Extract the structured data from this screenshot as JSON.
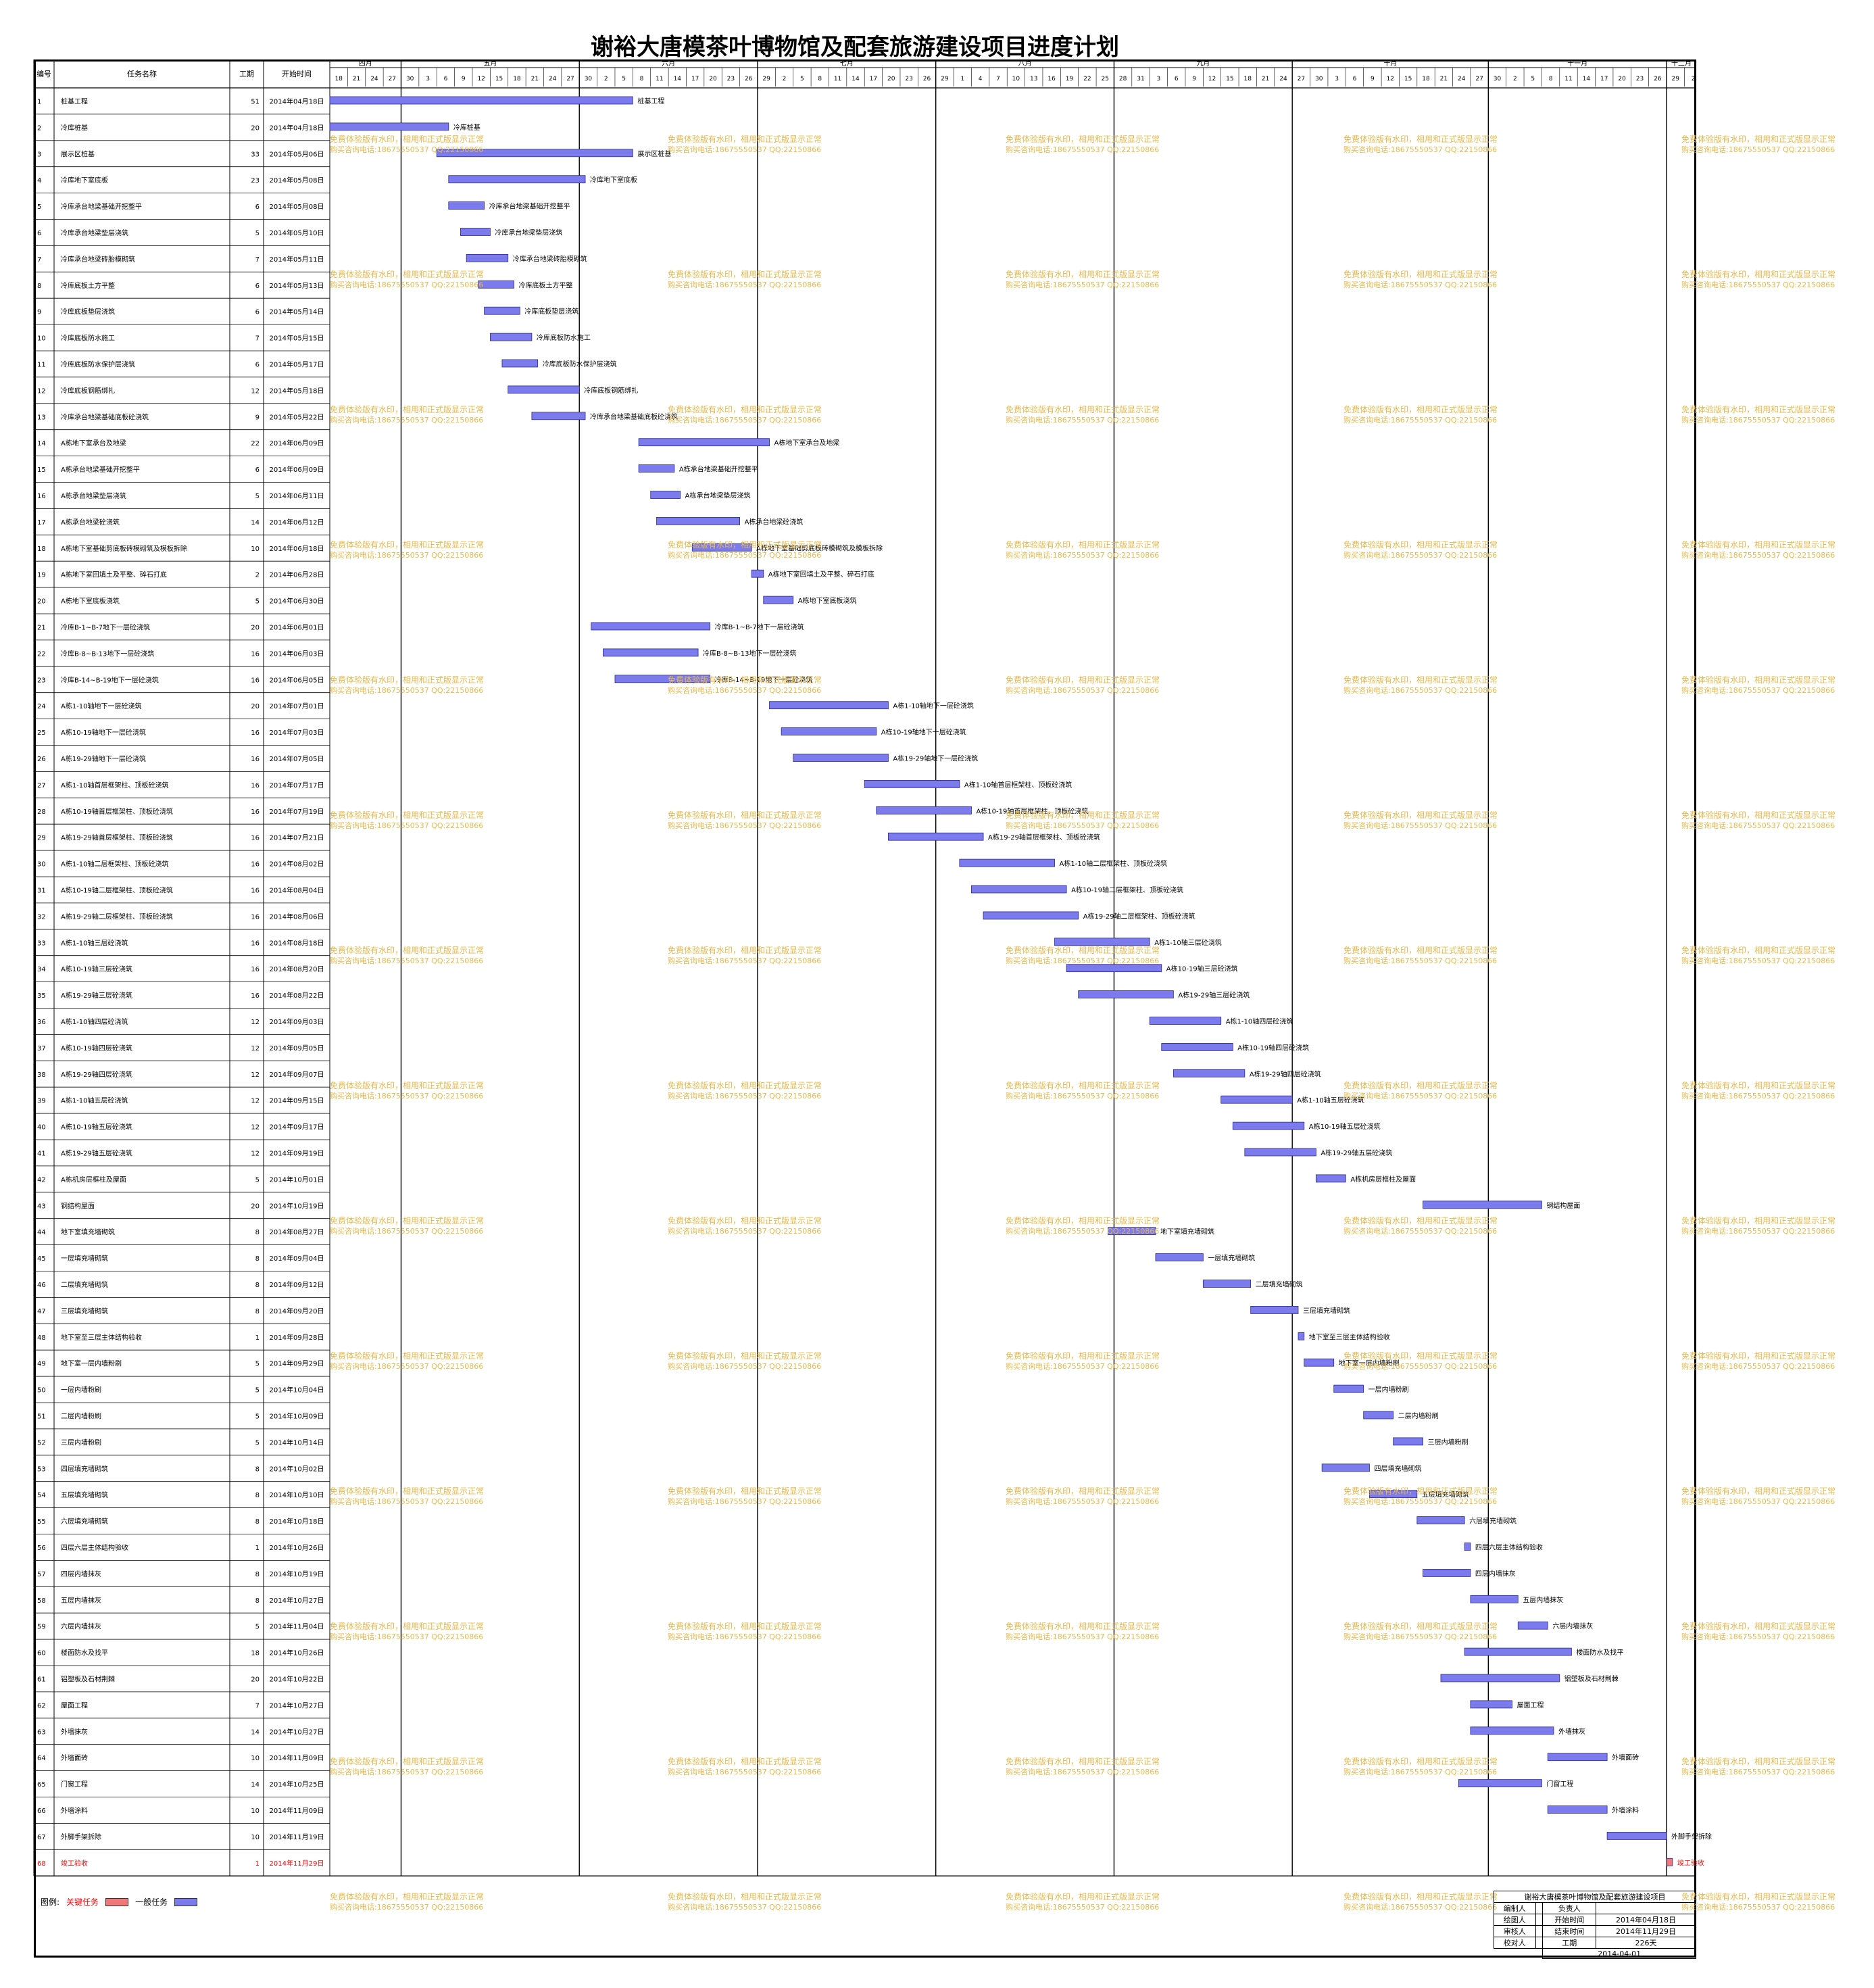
{
  "title": "谢裕大唐模茶叶博物馆及配套旅游建设项目进度计划",
  "columns": {
    "no": "编号",
    "name": "任务名称",
    "dur": "工期",
    "start": "开始时间"
  },
  "timeline": {
    "start": "2014-04-18",
    "end": "2014-12-04",
    "tick_days": 3,
    "months": [
      {
        "label": "四月",
        "start": "2014-04-18"
      },
      {
        "label": "五月",
        "start": "2014-04-30"
      },
      {
        "label": "六月",
        "start": "2014-05-30"
      },
      {
        "label": "七月",
        "start": "2014-06-29"
      },
      {
        "label": "八月",
        "start": "2014-07-29"
      },
      {
        "label": "九月",
        "start": "2014-08-28"
      },
      {
        "label": "十月",
        "start": "2014-09-27"
      },
      {
        "label": "十一月",
        "start": "2014-10-30"
      },
      {
        "label": "十二月",
        "start": "2014-11-29"
      }
    ]
  },
  "chart_data": {
    "type": "gantt",
    "tasks": [
      {
        "id": 1,
        "name": "桩基工程",
        "dur": 51,
        "start": "2014年04月18日"
      },
      {
        "id": 2,
        "name": "冷库桩基",
        "dur": 20,
        "start": "2014年04月18日"
      },
      {
        "id": 3,
        "name": "展示区桩基",
        "dur": 33,
        "start": "2014年05月06日"
      },
      {
        "id": 4,
        "name": "冷库地下室底板",
        "dur": 23,
        "start": "2014年05月08日"
      },
      {
        "id": 5,
        "name": "冷库承台地梁基础开挖整平",
        "dur": 6,
        "start": "2014年05月08日"
      },
      {
        "id": 6,
        "name": "冷库承台地梁垫层浇筑",
        "dur": 5,
        "start": "2014年05月10日"
      },
      {
        "id": 7,
        "name": "冷库承台地梁砖胎模砌筑",
        "dur": 7,
        "start": "2014年05月11日"
      },
      {
        "id": 8,
        "name": "冷库底板土方平整",
        "dur": 6,
        "start": "2014年05月13日"
      },
      {
        "id": 9,
        "name": "冷库底板垫层浇筑",
        "dur": 6,
        "start": "2014年05月14日"
      },
      {
        "id": 10,
        "name": "冷库底板防水施工",
        "dur": 7,
        "start": "2014年05月15日"
      },
      {
        "id": 11,
        "name": "冷库底板防水保护层浇筑",
        "dur": 6,
        "start": "2014年05月17日"
      },
      {
        "id": 12,
        "name": "冷库底板钢筋绑扎",
        "dur": 12,
        "start": "2014年05月18日"
      },
      {
        "id": 13,
        "name": "冷库承台地梁基础底板砼浇筑",
        "dur": 9,
        "start": "2014年05月22日"
      },
      {
        "id": 14,
        "name": "A栋地下室承台及地梁",
        "dur": 22,
        "start": "2014年06月09日"
      },
      {
        "id": 15,
        "name": "A栋承台地梁基础开挖整平",
        "dur": 6,
        "start": "2014年06月09日"
      },
      {
        "id": 16,
        "name": "A栋承台地梁垫层浇筑",
        "dur": 5,
        "start": "2014年06月11日"
      },
      {
        "id": 17,
        "name": "A栋承台地梁砼浇筑",
        "dur": 14,
        "start": "2014年06月12日"
      },
      {
        "id": 18,
        "name": "A栋地下室基础剪底板砖模砌筑及模板拆除",
        "dur": 10,
        "start": "2014年06月18日"
      },
      {
        "id": 19,
        "name": "A栋地下室回填土及平整、碎石打底",
        "dur": 2,
        "start": "2014年06月28日"
      },
      {
        "id": 20,
        "name": "A栋地下室底板浇筑",
        "dur": 5,
        "start": "2014年06月30日"
      },
      {
        "id": 21,
        "name": "冷库B-1~B-7地下一层砼浇筑",
        "dur": 20,
        "start": "2014年06月01日"
      },
      {
        "id": 22,
        "name": "冷库B-8~B-13地下一层砼浇筑",
        "dur": 16,
        "start": "2014年06月03日"
      },
      {
        "id": 23,
        "name": "冷库B-14~B-19地下一层砼浇筑",
        "dur": 16,
        "start": "2014年06月05日"
      },
      {
        "id": 24,
        "name": "A栋1-10轴地下一层砼浇筑",
        "dur": 20,
        "start": "2014年07月01日"
      },
      {
        "id": 25,
        "name": "A栋10-19轴地下一层砼浇筑",
        "dur": 16,
        "start": "2014年07月03日"
      },
      {
        "id": 26,
        "name": "A栋19-29轴地下一层砼浇筑",
        "dur": 16,
        "start": "2014年07月05日"
      },
      {
        "id": 27,
        "name": "A栋1-10轴首层框架柱、顶板砼浇筑",
        "dur": 16,
        "start": "2014年07月17日"
      },
      {
        "id": 28,
        "name": "A栋10-19轴首层框架柱、顶板砼浇筑",
        "dur": 16,
        "start": "2014年07月19日"
      },
      {
        "id": 29,
        "name": "A栋19-29轴首层框架柱、顶板砼浇筑",
        "dur": 16,
        "start": "2014年07月21日"
      },
      {
        "id": 30,
        "name": "A栋1-10轴二层框架柱、顶板砼浇筑",
        "dur": 16,
        "start": "2014年08月02日"
      },
      {
        "id": 31,
        "name": "A栋10-19轴二层框架柱、顶板砼浇筑",
        "dur": 16,
        "start": "2014年08月04日"
      },
      {
        "id": 32,
        "name": "A栋19-29轴二层框架柱、顶板砼浇筑",
        "dur": 16,
        "start": "2014年08月06日"
      },
      {
        "id": 33,
        "name": "A栋1-10轴三层砼浇筑",
        "dur": 16,
        "start": "2014年08月18日"
      },
      {
        "id": 34,
        "name": "A栋10-19轴三层砼浇筑",
        "dur": 16,
        "start": "2014年08月20日"
      },
      {
        "id": 35,
        "name": "A栋19-29轴三层砼浇筑",
        "dur": 16,
        "start": "2014年08月22日"
      },
      {
        "id": 36,
        "name": "A栋1-10轴四层砼浇筑",
        "dur": 12,
        "start": "2014年09月03日"
      },
      {
        "id": 37,
        "name": "A栋10-19轴四层砼浇筑",
        "dur": 12,
        "start": "2014年09月05日"
      },
      {
        "id": 38,
        "name": "A栋19-29轴四层砼浇筑",
        "dur": 12,
        "start": "2014年09月07日"
      },
      {
        "id": 39,
        "name": "A栋1-10轴五层砼浇筑",
        "dur": 12,
        "start": "2014年09月15日"
      },
      {
        "id": 40,
        "name": "A栋10-19轴五层砼浇筑",
        "dur": 12,
        "start": "2014年09月17日"
      },
      {
        "id": 41,
        "name": "A栋19-29轴五层砼浇筑",
        "dur": 12,
        "start": "2014年09月19日"
      },
      {
        "id": 42,
        "name": "A栋机房层框柱及屋面",
        "dur": 5,
        "start": "2014年10月01日"
      },
      {
        "id": 43,
        "name": "钢结构屋面",
        "dur": 20,
        "start": "2014年10月19日"
      },
      {
        "id": 44,
        "name": "地下室填充墙砌筑",
        "dur": 8,
        "start": "2014年08月27日"
      },
      {
        "id": 45,
        "name": "一层填充墙砌筑",
        "dur": 8,
        "start": "2014年09月04日"
      },
      {
        "id": 46,
        "name": "二层填充墙砌筑",
        "dur": 8,
        "start": "2014年09月12日"
      },
      {
        "id": 47,
        "name": "三层填充墙砌筑",
        "dur": 8,
        "start": "2014年09月20日"
      },
      {
        "id": 48,
        "name": "地下室至三层主体结构验收",
        "dur": 1,
        "start": "2014年09月28日"
      },
      {
        "id": 49,
        "name": "地下室一层内墙粉刷",
        "dur": 5,
        "start": "2014年09月29日"
      },
      {
        "id": 50,
        "name": "一层内墙粉刷",
        "dur": 5,
        "start": "2014年10月04日"
      },
      {
        "id": 51,
        "name": "二层内墙粉刷",
        "dur": 5,
        "start": "2014年10月09日"
      },
      {
        "id": 52,
        "name": "三层内墙粉刷",
        "dur": 5,
        "start": "2014年10月14日"
      },
      {
        "id": 53,
        "name": "四层填充墙砌筑",
        "dur": 8,
        "start": "2014年10月02日"
      },
      {
        "id": 54,
        "name": "五层填充墙砌筑",
        "dur": 8,
        "start": "2014年10月10日"
      },
      {
        "id": 55,
        "name": "六层填充墙砌筑",
        "dur": 8,
        "start": "2014年10月18日"
      },
      {
        "id": 56,
        "name": "四层六层主体结构验收",
        "dur": 1,
        "start": "2014年10月26日"
      },
      {
        "id": 57,
        "name": "四层内墙抹灰",
        "dur": 8,
        "start": "2014年10月19日"
      },
      {
        "id": 58,
        "name": "五层内墙抹灰",
        "dur": 8,
        "start": "2014年10月27日"
      },
      {
        "id": 59,
        "name": "六层内墙抹灰",
        "dur": 5,
        "start": "2014年11月04日"
      },
      {
        "id": 60,
        "name": "楼面防水及找平",
        "dur": 18,
        "start": "2014年10月26日"
      },
      {
        "id": 61,
        "name": "铝塑板及石材荆棘",
        "dur": 20,
        "start": "2014年10月22日"
      },
      {
        "id": 62,
        "name": "屋面工程",
        "dur": 7,
        "start": "2014年10月27日"
      },
      {
        "id": 63,
        "name": "外墙抹灰",
        "dur": 14,
        "start": "2014年10月27日"
      },
      {
        "id": 64,
        "name": "外墙面砖",
        "dur": 10,
        "start": "2014年11月09日"
      },
      {
        "id": 65,
        "name": "门窗工程",
        "dur": 14,
        "start": "2014年10月25日"
      },
      {
        "id": 66,
        "name": "外墙涂料",
        "dur": 10,
        "start": "2014年11月09日"
      },
      {
        "id": 67,
        "name": "外脚手架拆除",
        "dur": 10,
        "start": "2014年11月19日"
      },
      {
        "id": 68,
        "name": "竣工验收",
        "dur": 1,
        "start": "2014年11月29日",
        "critical": true
      }
    ]
  },
  "colors": {
    "normal": "#7b7bee",
    "critical": "#f07878",
    "critical_text": "#ff0000",
    "grid": "#000000",
    "watermark": "#e8b84a"
  },
  "legend": {
    "label": "图例:",
    "critical": "关键任务",
    "normal": "一般任务"
  },
  "watermark": {
    "line1": "免费体验版有水印，相用和正式版显示正常",
    "line2": "购买咨询电话:18675550537 QQ:22150866"
  },
  "titleblock": {
    "project": "谢裕大唐模茶叶博物馆及配套旅游建设项目",
    "rows": [
      [
        "编制人",
        "",
        "负责人",
        ""
      ],
      [
        "绘图人",
        "",
        "开始时间",
        "2014年04月18日"
      ],
      [
        "审核人",
        "",
        "结束时间",
        "2014年11月29日"
      ],
      [
        "校对人",
        "",
        "工期",
        "226天"
      ]
    ],
    "date": "2014-04-01"
  }
}
